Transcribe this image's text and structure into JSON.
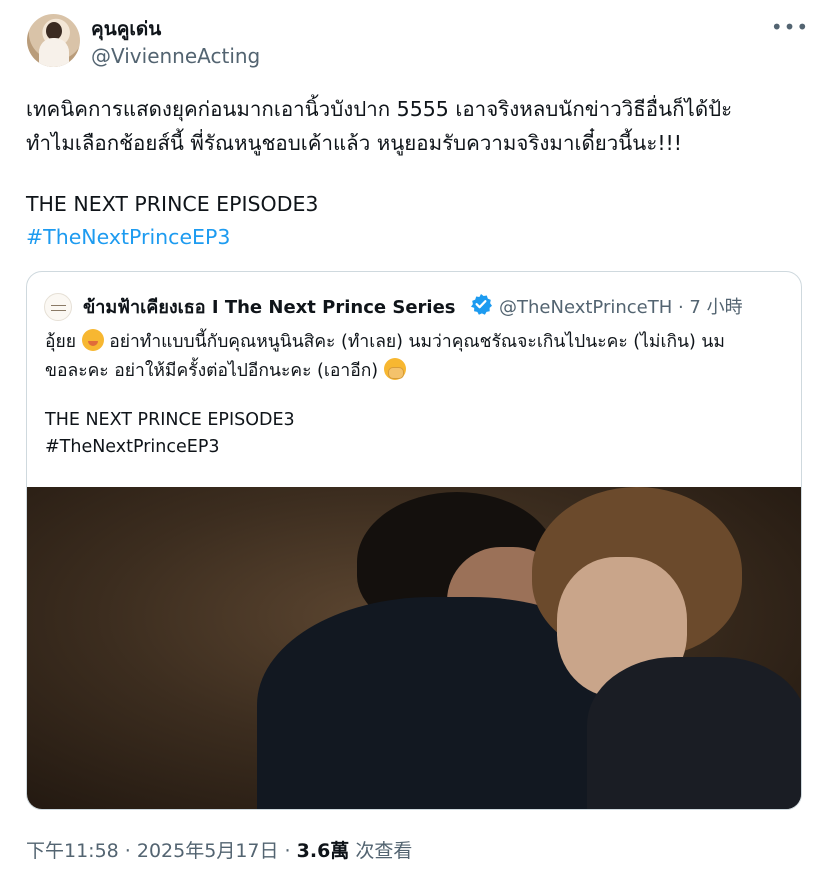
{
  "author": {
    "display_name": "คุนคูเด่น",
    "handle": "@VivienneActing"
  },
  "tweet": {
    "line1": "เทคนิคการแสดงยุคก่อนมากเอานิ้วบังปาก 5555 เอาจริงหลบนักข่าววิธีอื่นก็ได้ป้ะ",
    "line2": "ทำไมเลือกช้อยส์นี้ พี่รัณหนูชอบเค้าแล้ว หนูยอมรับความจริงมาเดี๋ยวนี้นะ!!!",
    "line3": "THE NEXT PRINCE EPISODE3",
    "hashtag": "#TheNextPrinceEP3"
  },
  "quote": {
    "name": "ข้ามฟ้าเคียงเธอ I The Next Prince Series",
    "handle_time": "@TheNextPrinceTH · 7 小時",
    "body_line1_a": "อุ้ยย",
    "body_line1_b": "อย่าทำแบบนี้กับคุณหนูนินสิคะ (ทำเลย) นมว่าคุณชรัณจะเกินไปนะคะ (ไม่เกิน) นม",
    "body_line2": "ขอละคะ อย่าให้มีครั้งต่อไปอีกนะคะ (เอาอีก)",
    "episode": "THE NEXT PRINCE EPISODE3",
    "hashtag": "#TheNextPrinceEP3"
  },
  "meta": {
    "time_date": "下午11:58 · 2025年5月17日 · ",
    "views_count": "3.6萬",
    "views_label": " 次查看"
  },
  "icons": {
    "more": "more-icon",
    "verified": "verified-badge-icon"
  },
  "colors": {
    "link": "#1d9bf0",
    "secondary_text": "#536471",
    "verified": "#1d9bf0"
  }
}
